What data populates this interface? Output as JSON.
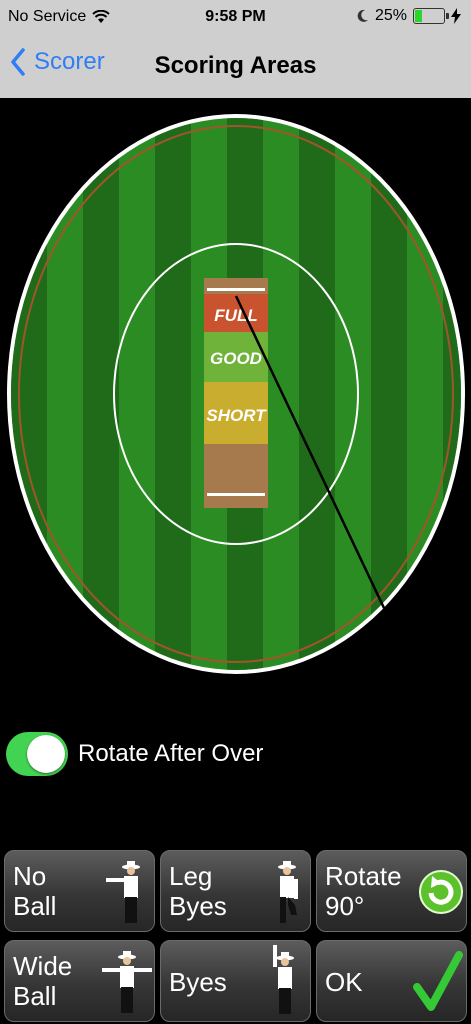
{
  "status_bar": {
    "carrier": "No Service",
    "time": "9:58 PM",
    "battery_percent": "25%"
  },
  "nav": {
    "back_label": "Scorer",
    "title": "Scoring Areas"
  },
  "pitch": {
    "zones": [
      "FULL",
      "GOOD",
      "SHORT"
    ]
  },
  "rotate_toggle": {
    "label": "Rotate After Over",
    "on": true
  },
  "buttons": {
    "no_ball": "No\nBall",
    "leg_byes": "Leg\nByes",
    "rotate": "Rotate\n90°",
    "wide_ball": "Wide\nBall",
    "byes": "Byes",
    "ok": "OK"
  },
  "colors": {
    "ios_blue": "#2f7ef5",
    "toggle_green": "#43d352",
    "ok_check": "#35c935",
    "full_zone": "#c8532e",
    "good_zone": "#6fb33a",
    "short_zone": "#c8ad2f"
  }
}
